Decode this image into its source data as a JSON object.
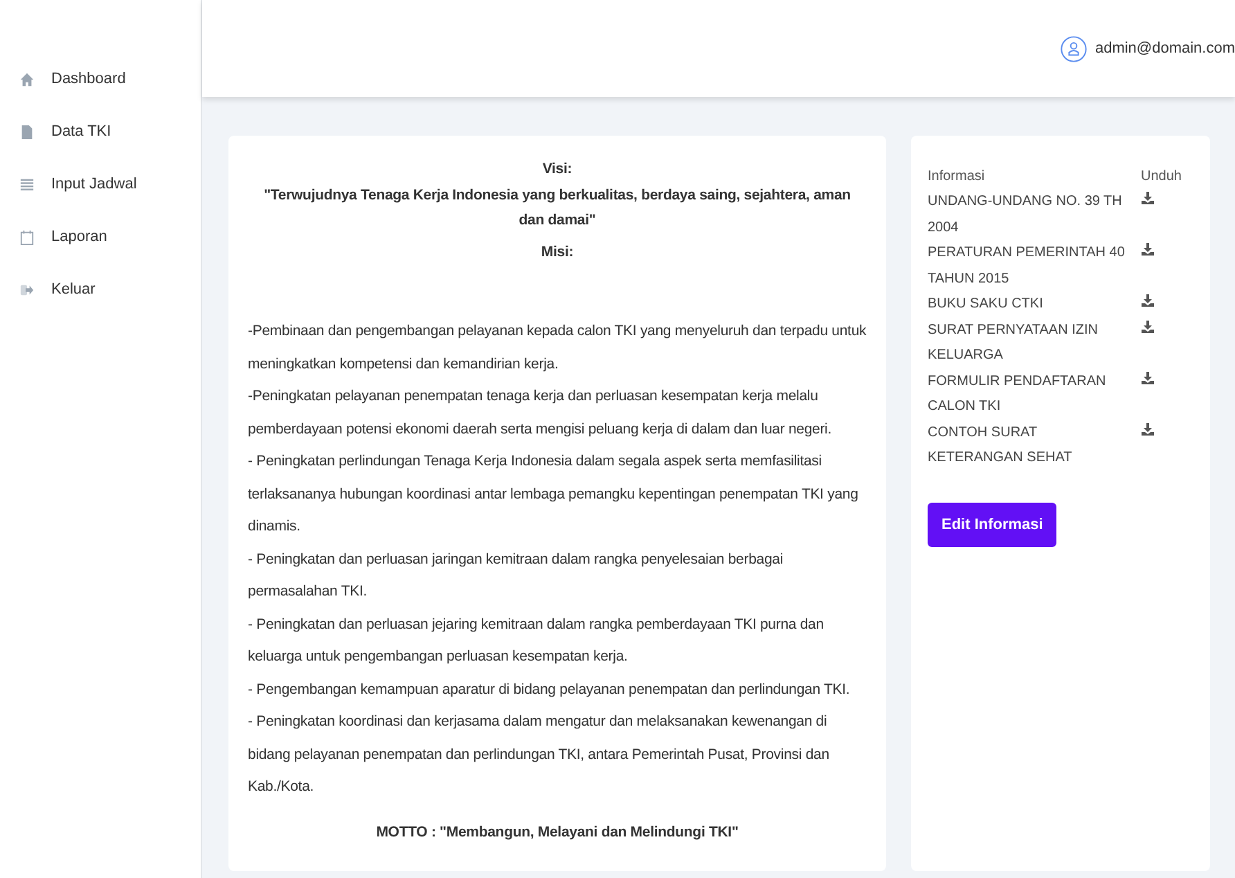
{
  "sidebar": {
    "items": [
      {
        "label": "Dashboard"
      },
      {
        "label": "Data TKI"
      },
      {
        "label": "Input Jadwal"
      },
      {
        "label": "Laporan"
      },
      {
        "label": "Keluar"
      }
    ]
  },
  "header": {
    "user_email": "admin@domain.com"
  },
  "profile_card": {
    "visi_label": "Visi:",
    "visi": "\"Terwujudnya Tenaga Kerja Indonesia yang berkualitas, berdaya saing, sejahtera, aman dan damai\"",
    "misi_label": "Misi:",
    "misi": [
      "-Pembinaan dan pengembangan pelayanan kepada calon TKI yang menyeluruh dan terpadu untuk meningkatkan kompetensi dan kemandirian kerja.",
      "-Peningkatan pelayanan penempatan tenaga kerja dan perluasan kesempatan kerja melalu pemberdayaan potensi ekonomi daerah serta mengisi peluang kerja di dalam dan luar negeri.",
      "- Peningkatan perlindungan Tenaga Kerja Indonesia dalam segala aspek serta memfasilitasi terlaksananya hubungan koordinasi antar lembaga pemangku kepentingan penempatan TKI yang dinamis.",
      "- Peningkatan dan perluasan jaringan kemitraan dalam rangka penyelesaian berbagai permasalahan TKI.",
      "- Peningkatan dan perluasan jejaring kemitraan dalam rangka pemberdayaan TKI purna dan keluarga untuk pengembangan perluasan kesempatan kerja.",
      "- Pengembangan kemampuan aparatur di bidang pelayanan penempatan dan perlindungan TKI.",
      "- Peningkatan koordinasi dan kerjasama dalam mengatur dan melaksanakan kewenangan di bidang pelayanan penempatan dan perlindungan TKI, antara Pemerintah Pusat, Provinsi dan Kab./Kota."
    ],
    "motto": "MOTTO : \"Membangun, Melayani dan Melindungi TKI\""
  },
  "info_card": {
    "columns": [
      "Informasi",
      "Unduh"
    ],
    "rows": [
      {
        "title": "UNDANG-UNDANG NO. 39 TH 2004"
      },
      {
        "title": "PERATURAN PEMERINTAH 40 TAHUN 2015"
      },
      {
        "title": "BUKU SAKU CTKI"
      },
      {
        "title": "SURAT PERNYATAAN IZIN KELUARGA"
      },
      {
        "title": "FORMULIR PENDAFTARAN CALON TKI"
      },
      {
        "title": "CONTOH SURAT KETERANGAN SEHAT"
      }
    ],
    "button": "Edit Informasi"
  }
}
